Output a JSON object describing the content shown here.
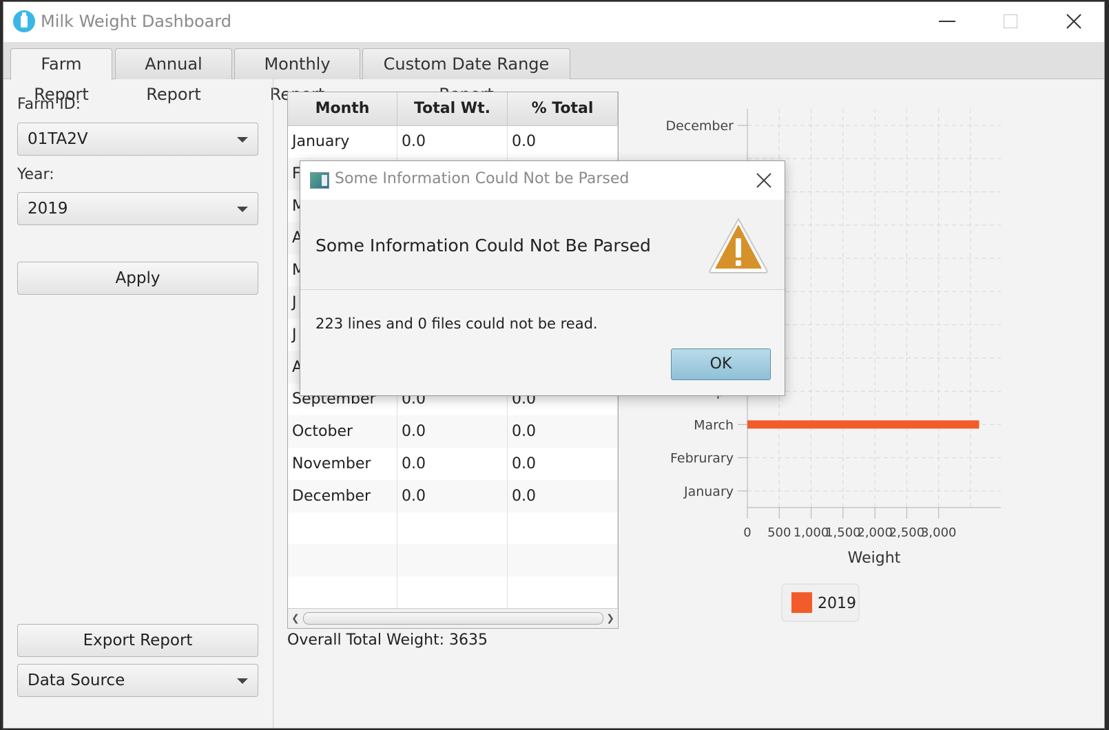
{
  "window": {
    "title": "Milk Weight Dashboard"
  },
  "tabs": [
    {
      "label": "Farm Report",
      "active": true
    },
    {
      "label": "Annual Report",
      "active": false
    },
    {
      "label": "Monthly Report",
      "active": false
    },
    {
      "label": "Custom Date Range Report",
      "active": false
    }
  ],
  "left": {
    "farm_label": "Farm ID:",
    "farm_value": "01TA2V",
    "year_label": "Year:",
    "year_value": "2019",
    "apply_label": "Apply",
    "export_label": "Export Report",
    "source_value": "Data Source"
  },
  "table": {
    "columns": [
      "Month",
      "Total Wt.",
      "% Total"
    ],
    "rows": [
      [
        "January",
        "0.0",
        "0.0"
      ],
      [
        "F",
        "",
        ""
      ],
      [
        "M",
        "",
        ""
      ],
      [
        "A",
        "",
        ""
      ],
      [
        "M",
        "",
        ""
      ],
      [
        "J",
        "",
        ""
      ],
      [
        "J",
        "",
        ""
      ],
      [
        "A",
        "",
        ""
      ],
      [
        "September",
        "0.0",
        "0.0"
      ],
      [
        "October",
        "0.0",
        "0.0"
      ],
      [
        "November",
        "0.0",
        "0.0"
      ],
      [
        "December",
        "0.0",
        "0.0"
      ],
      [
        "",
        "",
        ""
      ],
      [
        "",
        "",
        ""
      ],
      [
        "",
        "",
        ""
      ]
    ],
    "overall_total": "Overall Total Weight: 3635"
  },
  "chart_data": {
    "type": "bar",
    "orientation": "horizontal",
    "categories": [
      "January",
      "Februrary",
      "March",
      "Apri",
      "",
      "",
      "",
      "",
      "",
      "",
      "",
      "December"
    ],
    "visible_category_labels": [
      "December",
      "Apri",
      "March",
      "Februrary",
      "January"
    ],
    "series": [
      {
        "name": "2019",
        "values": [
          0,
          0,
          3635,
          0,
          0,
          0,
          0,
          0,
          0,
          0,
          0,
          0
        ],
        "color": "#f25c2b"
      }
    ],
    "xlabel": "Weight",
    "x_ticks": [
      "0",
      "500",
      "1,000",
      "1,500",
      "2,000",
      "2,500",
      "3,000"
    ],
    "xlim": [
      0,
      4000
    ],
    "grid": true,
    "legend": "bottom-center"
  },
  "dialog": {
    "title": "Some Information Could Not be Parsed",
    "header": "Some Information Could Not Be Parsed",
    "content": "223 lines and 0 files could not be read.",
    "ok_label": "OK"
  }
}
